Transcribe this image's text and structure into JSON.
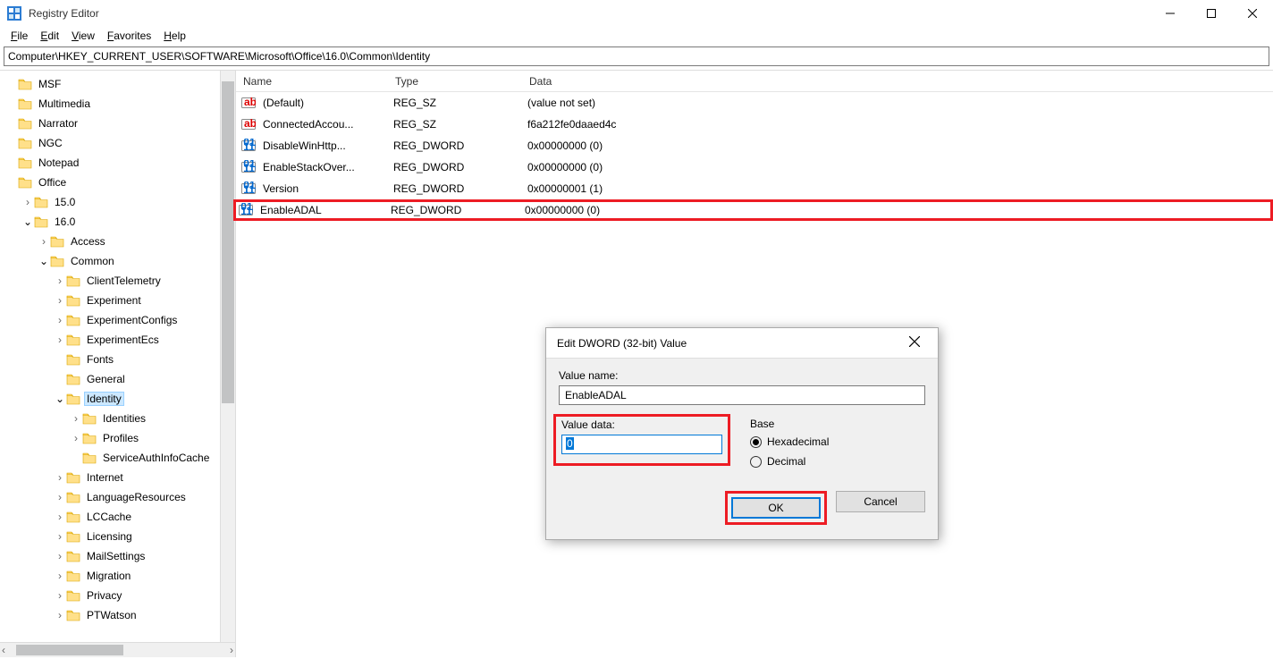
{
  "window": {
    "title": "Registry Editor",
    "min": "Minimize",
    "max": "Maximize",
    "close": "Close"
  },
  "menu": {
    "file": "File",
    "edit": "Edit",
    "view": "View",
    "favorites": "Favorites",
    "help": "Help"
  },
  "address": "Computer\\HKEY_CURRENT_USER\\SOFTWARE\\Microsoft\\Office\\16.0\\Common\\Identity",
  "tree": [
    {
      "d": 1,
      "c": "",
      "l": "MSF"
    },
    {
      "d": 1,
      "c": "",
      "l": "Multimedia"
    },
    {
      "d": 1,
      "c": "",
      "l": "Narrator"
    },
    {
      "d": 1,
      "c": "",
      "l": "NGC"
    },
    {
      "d": 1,
      "c": "",
      "l": "Notepad"
    },
    {
      "d": 1,
      "c": "",
      "l": "Office"
    },
    {
      "d": 2,
      "c": ">",
      "l": "15.0"
    },
    {
      "d": 2,
      "c": "v",
      "l": "16.0"
    },
    {
      "d": 3,
      "c": ">",
      "l": "Access"
    },
    {
      "d": 3,
      "c": "v",
      "l": "Common"
    },
    {
      "d": 4,
      "c": ">",
      "l": "ClientTelemetry"
    },
    {
      "d": 4,
      "c": ">",
      "l": "Experiment"
    },
    {
      "d": 4,
      "c": ">",
      "l": "ExperimentConfigs"
    },
    {
      "d": 4,
      "c": ">",
      "l": "ExperimentEcs"
    },
    {
      "d": 4,
      "c": "",
      "l": "Fonts"
    },
    {
      "d": 4,
      "c": "",
      "l": "General"
    },
    {
      "d": 4,
      "c": "v",
      "l": "Identity",
      "sel": true
    },
    {
      "d": 5,
      "c": ">",
      "l": "Identities"
    },
    {
      "d": 5,
      "c": ">",
      "l": "Profiles"
    },
    {
      "d": 5,
      "c": "",
      "l": "ServiceAuthInfoCache"
    },
    {
      "d": 4,
      "c": ">",
      "l": "Internet"
    },
    {
      "d": 4,
      "c": ">",
      "l": "LanguageResources"
    },
    {
      "d": 4,
      "c": ">",
      "l": "LCCache"
    },
    {
      "d": 4,
      "c": ">",
      "l": "Licensing"
    },
    {
      "d": 4,
      "c": ">",
      "l": "MailSettings"
    },
    {
      "d": 4,
      "c": ">",
      "l": "Migration"
    },
    {
      "d": 4,
      "c": ">",
      "l": "Privacy"
    },
    {
      "d": 4,
      "c": ">",
      "l": "PTWatson"
    }
  ],
  "list": {
    "header": {
      "name": "Name",
      "type": "Type",
      "data": "Data"
    },
    "rows": [
      {
        "icon": "sz",
        "name": "(Default)",
        "type": "REG_SZ",
        "data": "(value not set)"
      },
      {
        "icon": "sz",
        "name": "ConnectedAccou...",
        "type": "REG_SZ",
        "data": "f6a212fe0daaed4c"
      },
      {
        "icon": "dword",
        "name": "DisableWinHttp...",
        "type": "REG_DWORD",
        "data": "0x00000000 (0)"
      },
      {
        "icon": "dword",
        "name": "EnableStackOver...",
        "type": "REG_DWORD",
        "data": "0x00000000 (0)"
      },
      {
        "icon": "dword",
        "name": "Version",
        "type": "REG_DWORD",
        "data": "0x00000001 (1)"
      },
      {
        "icon": "dword",
        "name": "EnableADAL",
        "type": "REG_DWORD",
        "data": "0x00000000 (0)",
        "hl": true
      }
    ]
  },
  "dialog": {
    "title": "Edit DWORD (32-bit) Value",
    "valueNameLabel": "Value name:",
    "valueName": "EnableADAL",
    "valueDataLabel": "Value data:",
    "valueData": "0",
    "baseLabel": "Base",
    "hex": "Hexadecimal",
    "dec": "Decimal",
    "ok": "OK",
    "cancel": "Cancel"
  }
}
